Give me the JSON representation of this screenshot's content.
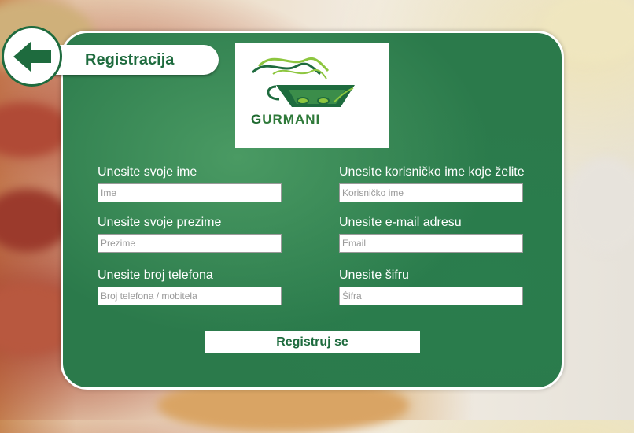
{
  "header": {
    "title": "Registracija",
    "back_icon": "arrow-left-icon"
  },
  "logo": {
    "brand_first": "G",
    "brand_rest": "URMANI",
    "colors": {
      "primary": "#1e6b3e",
      "accent": "#8dc63f"
    }
  },
  "form": {
    "name": {
      "label": "Unesite svoje ime",
      "placeholder": "Ime"
    },
    "surname": {
      "label": "Unesite svoje prezime",
      "placeholder": "Prezime"
    },
    "phone": {
      "label": "Unesite broj telefona",
      "placeholder": "Broj telefona / mobitela"
    },
    "username": {
      "label": "Unesite korisničko ime koje želite",
      "placeholder": "Korisničko ime"
    },
    "email": {
      "label": "Unesite e-mail adresu",
      "placeholder": "Email"
    },
    "password": {
      "label": "Unesite šifru",
      "placeholder": "Šifra"
    },
    "submit_label": "Registruj se"
  },
  "colors": {
    "panel": "#2b7a4b",
    "accent_dark": "#1e6b3e",
    "text_light": "#ffffff"
  }
}
